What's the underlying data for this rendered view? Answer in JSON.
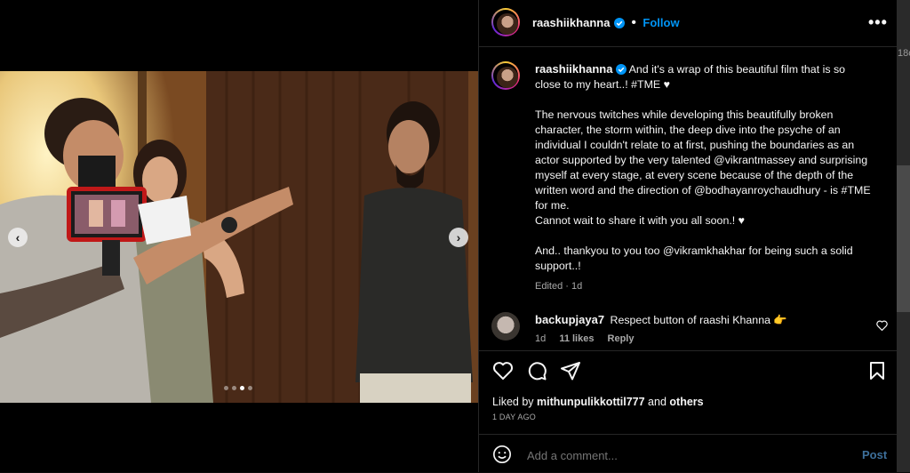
{
  "header": {
    "username": "raashiikhanna",
    "separator": "•",
    "follow_label": "Follow",
    "more_icon": "more-horizontal-icon"
  },
  "media": {
    "slide_current": 3,
    "slide_total": 4,
    "prev_icon": "chevron-left-icon",
    "next_icon": "chevron-right-icon"
  },
  "caption": {
    "username": "raashiikhanna",
    "lines": [
      "And it's a wrap of this beautiful film that is so close to my heart..! #TME ♥",
      "",
      "The nervous twitches while developing this beautifully broken character, the storm within, the deep dive into the psyche of an individual I couldn't relate to at first, pushing the boundaries as an actor supported by the very talented @vikrantmassey and surprising myself at every stage, at every scene because of the depth of the written word and the direction of @bodhayanroychaudhury - is #TME for me.",
      "Cannot wait to share it with you all soon.! ♥",
      "",
      "And.. thankyou to you too @vikramkhakhar for being such a solid support..!"
    ],
    "meta": "Edited · 1d"
  },
  "comment": {
    "username": "backupjaya7",
    "text": "Respect button of raashi Khanna 👉",
    "age": "1d",
    "likes": "11 likes",
    "reply_label": "Reply"
  },
  "actions": {
    "like_icon": "heart-icon",
    "comment_icon": "comment-icon",
    "share_icon": "share-icon",
    "save_icon": "bookmark-icon"
  },
  "likes": {
    "prefix": "Liked by ",
    "user": "mithunpulikkottil777",
    "middle": " and ",
    "others": "others"
  },
  "posted_ago": "1 DAY AGO",
  "add_comment": {
    "placeholder": "Add a comment...",
    "post_label": "Post",
    "emoji_icon": "emoji-icon"
  },
  "backdrop": {
    "peek_text": "18c"
  }
}
